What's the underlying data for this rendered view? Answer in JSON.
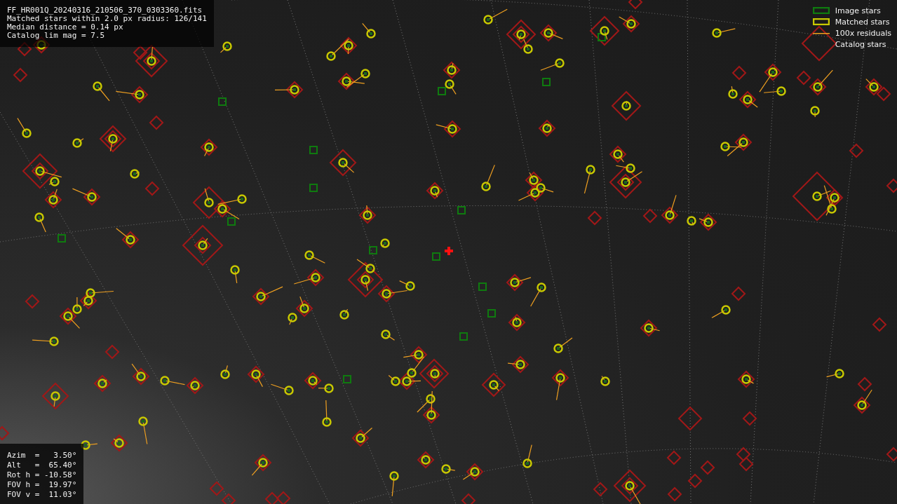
{
  "info_lines": [
    "FF_HR001Q_20240316_210506_370_0303360.fits",
    "Matched stars within 2.0 px radius: 126/141",
    "Median distance = 0.14 px",
    "Catalog lim mag = 7.5"
  ],
  "legend": [
    {
      "kind": "image",
      "label": "Image stars"
    },
    {
      "kind": "matched",
      "label": "Matched stars"
    },
    {
      "kind": "residual",
      "label": "100x residuals"
    },
    {
      "kind": "catalog",
      "label": "Catalog stars"
    }
  ],
  "pointing": [
    "Azim  =   3.50°",
    "Alt   =  65.40°",
    "Rot h = -10.58°",
    "FOV h =  19.97°",
    "FOV v =  11.03°"
  ]
}
